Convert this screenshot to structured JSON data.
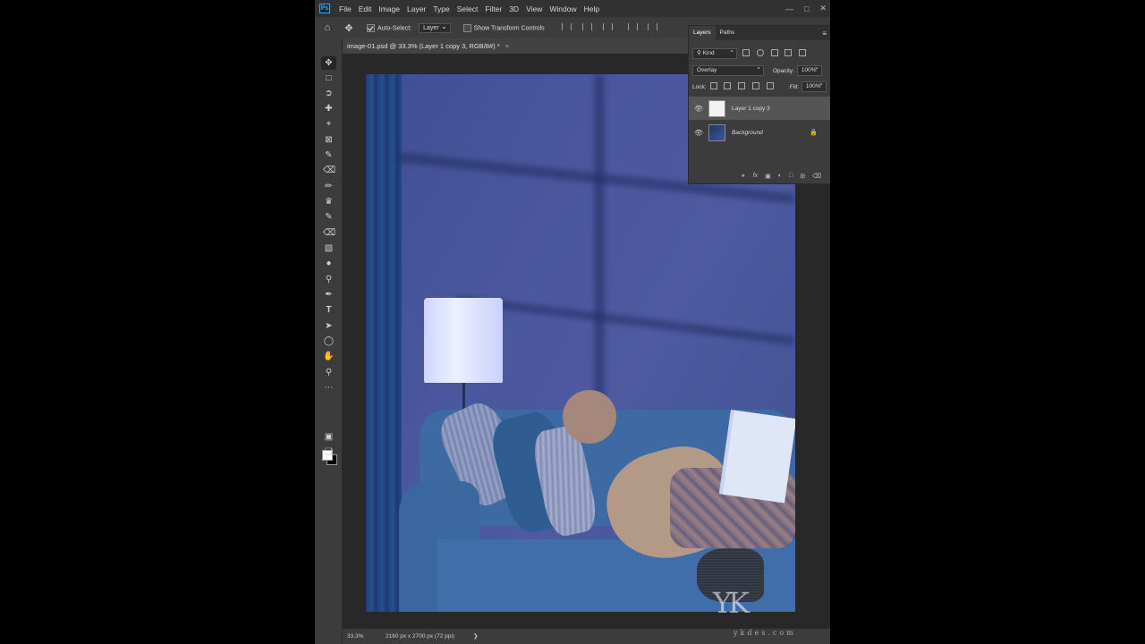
{
  "menu": {
    "logo": "Ps",
    "items": [
      "File",
      "Edit",
      "Image",
      "Layer",
      "Type",
      "Select",
      "Filter",
      "3D",
      "View",
      "Window",
      "Help"
    ],
    "window_controls": [
      "—",
      "□",
      "✕"
    ]
  },
  "options": {
    "auto_select_label": "Auto-Select:",
    "auto_select_checked": true,
    "auto_select_value": "Layer",
    "transform_label": "Show Transform Controls",
    "transform_checked": false
  },
  "document": {
    "tab_title": "image-01.psd @ 33.3% (Layer 1 copy 3, RGB/8#) *",
    "zoom": "33.3%",
    "info": "2160 px x 2700 px (72 ppi)"
  },
  "layers_panel": {
    "tabs": [
      "Layers",
      "Paths"
    ],
    "kind_filter": "Kind",
    "blend_mode": "Overlay",
    "opacity_label": "Opacity:",
    "opacity_value": "100%",
    "lock_label": "Lock:",
    "fill_label": "Fill:",
    "fill_value": "100%",
    "layers": [
      {
        "name": "Layer 1 copy 3",
        "visible": true,
        "selected": true
      },
      {
        "name": "Background",
        "visible": true,
        "locked": true,
        "selected": false
      }
    ]
  },
  "watermark": {
    "logo": "YK",
    "text": "ykdes.com"
  }
}
